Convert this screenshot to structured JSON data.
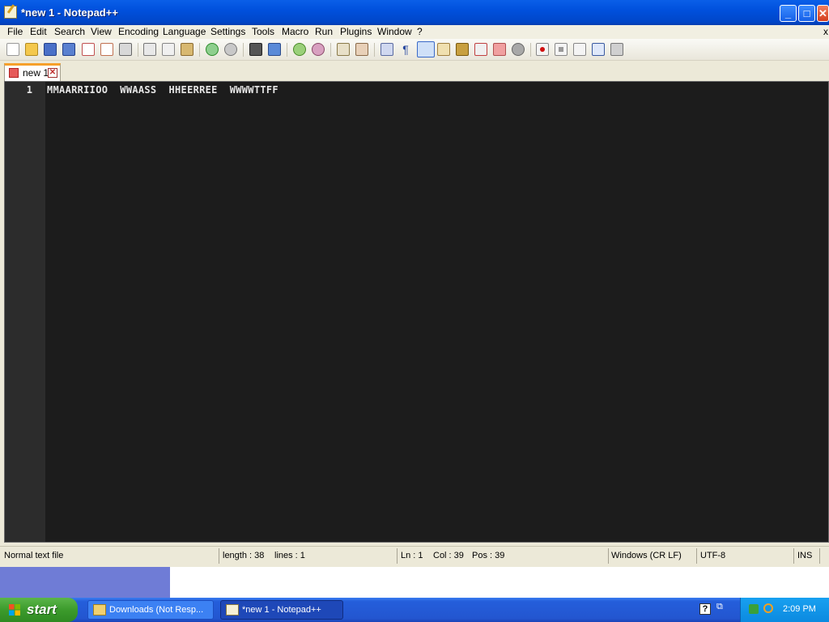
{
  "window": {
    "title": "*new 1 - Notepad++",
    "buttons": {
      "minimize": "_",
      "maximize": "□",
      "close": "✕"
    }
  },
  "menu": [
    "File",
    "Edit",
    "Search",
    "View",
    "Encoding",
    "Language",
    "Settings",
    "Tools",
    "Macro",
    "Run",
    "Plugins",
    "Window",
    "?"
  ],
  "menu_close": "x",
  "toolbar_icons": [
    "new-file-icon",
    "open-file-icon",
    "save-icon",
    "save-all-icon",
    "close-icon",
    "close-all-icon",
    "print-icon",
    "cut-icon",
    "copy-icon",
    "paste-icon",
    "undo-icon",
    "redo-icon",
    "find-icon",
    "replace-icon",
    "zoom-in-icon",
    "zoom-out-icon",
    "sync-vertical-icon",
    "sync-horizontal-icon",
    "word-wrap-icon",
    "show-all-chars-icon",
    "indent-guide-icon",
    "user-language-icon",
    "doc-map-icon",
    "function-list-icon",
    "folder-workspace-icon",
    "monitor-icon",
    "record-macro-icon",
    "stop-macro-icon",
    "play-macro-icon",
    "run-macro-multiple-icon",
    "save-macro-icon"
  ],
  "tabs": [
    {
      "label": "new 1"
    }
  ],
  "editor": {
    "line_number": "1",
    "text": "MMAARRIIOO  WWAASS  HHEERREE  WWWWTTFF"
  },
  "statusbar": {
    "filetype": "Normal text file",
    "length": "length : 38",
    "lines": "lines : 1",
    "ln": "Ln : 1",
    "col": "Col : 39",
    "pos": "Pos : 39",
    "eol": "Windows (CR LF)",
    "encoding": "UTF-8",
    "mode": "INS"
  },
  "taskbar": {
    "start": "start",
    "tasks": [
      {
        "label": "Downloads (Not Resp..."
      },
      {
        "label": "*new 1 - Notepad++"
      }
    ],
    "clock": "2:09 PM",
    "help": "?"
  },
  "colors": {
    "editor_bg": "#1c1c1c",
    "gutter_bg": "#2c2c2c",
    "titlebar": "#0050dc",
    "taskbar": "#245edb",
    "start": "#3c9b2c"
  }
}
